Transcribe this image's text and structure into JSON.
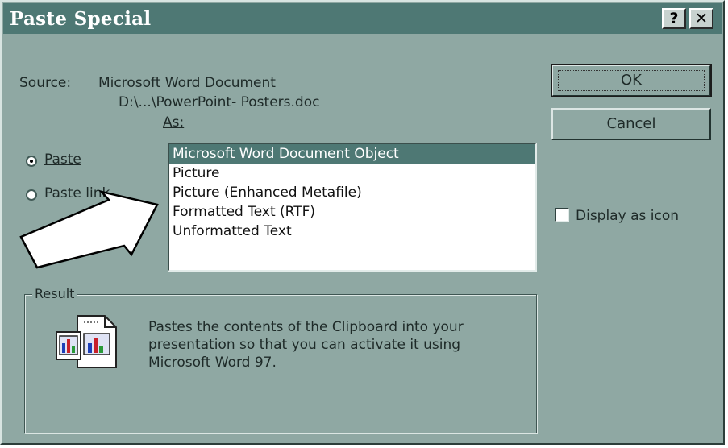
{
  "window": {
    "title": "Paste Special",
    "help_label": "?",
    "close_label": "✕"
  },
  "source": {
    "label": "Source:",
    "line1": "Microsoft Word Document",
    "line2": "D:\\...\\PowerPoint- Posters.doc"
  },
  "as_label": "As:",
  "options": {
    "paste_label": "Paste",
    "paste_selected": true,
    "paste_link_label": "Paste link"
  },
  "formats": [
    {
      "label": "Microsoft Word Document Object",
      "selected": true
    },
    {
      "label": "Picture",
      "selected": false
    },
    {
      "label": "Picture (Enhanced Metafile)",
      "selected": false
    },
    {
      "label": "Formatted Text (RTF)",
      "selected": false
    },
    {
      "label": "Unformatted Text",
      "selected": false
    }
  ],
  "buttons": {
    "ok": "OK",
    "cancel": "Cancel"
  },
  "display_as_icon": {
    "label": "Display as icon",
    "checked": false
  },
  "result": {
    "label": "Result",
    "text": "Pastes the contents of the Clipboard into your presentation so that you can activate it using Microsoft Word 97."
  },
  "icons": {
    "result_icon": "embedded-chart-documents-icon",
    "arrow": "pointer-arrow-icon"
  },
  "colors": {
    "face": "#8fa8a3",
    "title_bar": "#4e7874",
    "selection": "#4e7874"
  }
}
